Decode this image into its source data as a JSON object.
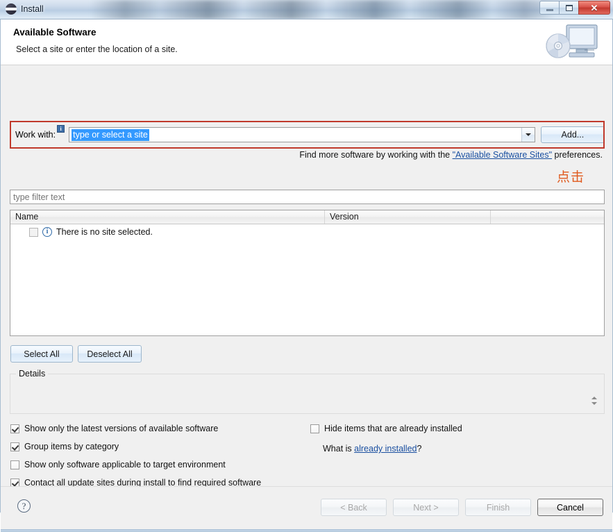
{
  "window": {
    "title": "Install",
    "icon": "eclipse-icon",
    "caption_buttons": {
      "minimize": "minimize-button",
      "maximize": "maximize-button",
      "close": "✕"
    }
  },
  "banner": {
    "title": "Available Software",
    "subtitle": "Select a site or enter the location of a site.",
    "icon": "computer-disc-icon"
  },
  "work_with": {
    "label": "Work with:",
    "badge": "i",
    "value": "type or select a site",
    "placeholder": "type or select a site",
    "add_button": "Add...",
    "highlight_color": "#c0392b",
    "selection_color": "#3399ff"
  },
  "find_line": {
    "before": "Find more software by working with the ",
    "link": "\"Available Software Sites\"",
    "after": " preferences."
  },
  "annotation": {
    "text": "点击",
    "color": "#e05a1e"
  },
  "filter": {
    "placeholder": "type filter text",
    "value": ""
  },
  "table": {
    "columns": [
      "Name",
      "Version",
      ""
    ],
    "rows": [
      {
        "checked": false,
        "icon": "info-icon",
        "name": "There is no site selected.",
        "version": ""
      }
    ]
  },
  "selection_buttons": {
    "select_all": "Select All",
    "deselect_all": "Deselect All"
  },
  "details": {
    "legend": "Details",
    "content": ""
  },
  "options": {
    "left": [
      {
        "label": "Show only the latest versions of available software",
        "checked": true
      },
      {
        "label": "Group items by category",
        "checked": true
      },
      {
        "label": "Show only software applicable to target environment",
        "checked": false
      },
      {
        "label": "Contact all update sites during install to find required software",
        "checked": true
      }
    ],
    "right": [
      {
        "label": "Hide items that are already installed",
        "checked": false
      }
    ],
    "what_is": {
      "before": "What is ",
      "link": "already installed",
      "after": "?"
    }
  },
  "footer": {
    "help": "?",
    "buttons": [
      {
        "label": "< Back",
        "enabled": false
      },
      {
        "label": "Next >",
        "enabled": false
      },
      {
        "label": "Finish",
        "enabled": false
      },
      {
        "label": "Cancel",
        "enabled": true
      }
    ]
  }
}
